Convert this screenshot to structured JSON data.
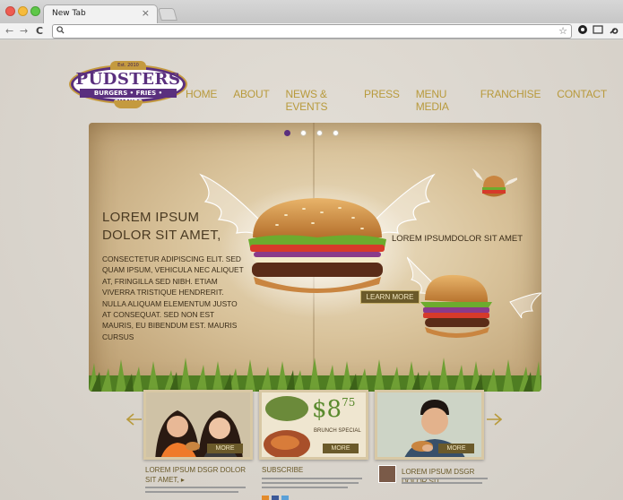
{
  "browser": {
    "tab_title": "New Tab",
    "tab_close": "×",
    "address_value": "",
    "back": "←",
    "forward": "→",
    "reload": "C",
    "search_glyph": "🔍",
    "star_glyph": "☆"
  },
  "site": {
    "logo": {
      "top_text": "Est. 2010",
      "name": "PUDSTERS",
      "tagline": "BURGERS • FRIES • SHAKES"
    },
    "nav": [
      "HOME",
      "ABOUT",
      "NEWS & EVENTS",
      "PRESS",
      "MENU MEDIA",
      "FRANCHISE",
      "CONTACT"
    ],
    "hero": {
      "title": "LOREM IPSUM DOLOR SIT AMET,",
      "body": "CONSECTETUR ADIPISCING ELIT. SED QUAM IPSUM, VEHICULA NEC ALIQUET AT, FRINGILLA SED NIBH. ETIAM VIVERRA TRISTIQUE HENDRERIT. NULLA ALIQUAM ELEMENTUM JUSTO AT CONSEQUAT. SED NON EST MAURIS, EU BIBENDUM EST. MAURIS CURSUS",
      "caption": "LOREM IPSUMDOLOR SIT AMET",
      "learn_more": "LEARN MORE",
      "slide_count": 4,
      "active_slide": 1
    },
    "cards": {
      "more_label": "MORE",
      "price_main": "$8",
      "price_cents": "75",
      "price_note": "BRUNCH SPECIAL"
    },
    "columns": {
      "left_title": "LOREM IPSUM DSGR DOLOR SIT AMET, ▸",
      "middle_title": "SUBSCRIBE",
      "right_title": "LOREM IPSUM DSGR DOLOR SIT"
    },
    "colors": {
      "brand_purple": "#5a2f7e",
      "brand_gold": "#c49a3f",
      "nav_gold": "#b89a3c"
    }
  }
}
